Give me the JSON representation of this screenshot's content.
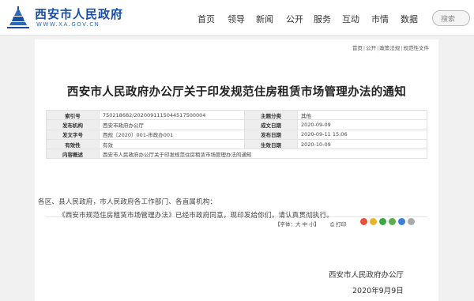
{
  "header": {
    "site_name": "西安市人民政府",
    "site_url": "WWW.XA.GOV.CN",
    "nav": [
      "首页",
      "领导",
      "新闻",
      "公开",
      "服务",
      "互动",
      "市情",
      "数据"
    ],
    "search_placeholder": "搜索"
  },
  "breadcrumb": [
    "首页",
    "公开",
    "政策法规",
    "规范性文件"
  ],
  "article": {
    "title": "西安市人民政府办公厅关于印发规范住房租赁市场管理办法的通知",
    "info": {
      "index_label": "索引号",
      "index_value": "750218682/2020091115044517500004",
      "topic_label": "主题分类",
      "topic_value": "其他",
      "issuer_label": "发布机构",
      "issuer_value": "西安市政府办公厅",
      "created_label": "成文日期",
      "created_value": "2020-09-09",
      "docno_label": "发文字号",
      "docno_value": "西规〔2020〕001-市政办001",
      "published_label": "发布日期",
      "published_value": "2020-09-11 15:06",
      "validity_label": "有效性",
      "validity_value": "有效",
      "effective_label": "生效日期",
      "effective_value": "2020-10-09",
      "summary_label": "内容概述",
      "summary_value": "西安市人民政府办公厅关于印发规范住房租赁市场管理办法的通知"
    },
    "toolbar": {
      "font_label": "【字体：大 中 小】",
      "print_label": "打印"
    },
    "body": [
      "各区、县人民政府，市人民政府各工作部门、各直属机构：",
      "《西安市规范住房租赁市场管理办法》已经市政府同意，现印发给你们，请认真贯彻执行。"
    ],
    "signer": "西安市人民政府办公厅",
    "sign_date": "2020年9月9日"
  },
  "colors": {
    "brand": "#1a4fa0",
    "band": "#f1f1f1"
  }
}
